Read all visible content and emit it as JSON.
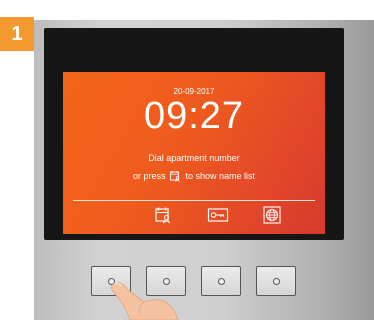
{
  "step_badge": "1",
  "screen": {
    "date": "20-09-2017",
    "time": "09:27",
    "message_line1": "Dial apartment number",
    "message_line2_before": "or press",
    "message_line2_after": "to show name list",
    "bottom_icons": [
      "contacts-icon",
      "key-icon",
      "globe-icon"
    ],
    "background_color": "#f05f1c"
  },
  "physical_buttons": [
    "button-1",
    "button-2",
    "button-3",
    "button-4"
  ],
  "colors": {
    "badge": "#f29a2e",
    "screen_accent": "#f05f1c"
  }
}
